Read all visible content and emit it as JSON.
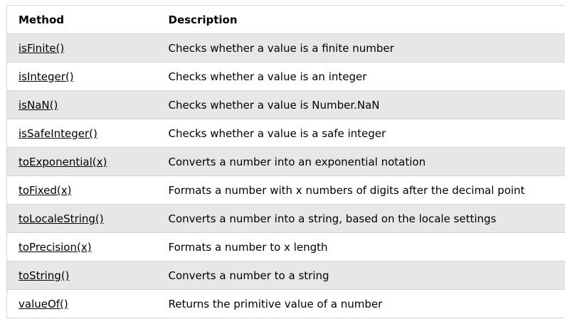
{
  "table": {
    "headers": {
      "method": "Method",
      "description": "Description"
    },
    "rows": [
      {
        "method": "isFinite()",
        "description": "Checks whether a value is a finite number"
      },
      {
        "method": "isInteger()",
        "description": "Checks whether a value is an integer"
      },
      {
        "method": "isNaN()",
        "description": "Checks whether a value is Number.NaN"
      },
      {
        "method": "isSafeInteger()",
        "description": "Checks whether a value is a safe integer"
      },
      {
        "method": "toExponential(x)",
        "description": "Converts a number into an exponential notation"
      },
      {
        "method": "toFixed(x)",
        "description": "Formats a number with x numbers of digits after the decimal point"
      },
      {
        "method": "toLocaleString()",
        "description": "Converts a number into a string, based on the locale settings"
      },
      {
        "method": "toPrecision(x)",
        "description": "Formats a number to x length"
      },
      {
        "method": "toString()",
        "description": "Converts a number to a string"
      },
      {
        "method": "valueOf()",
        "description": "Returns the primitive value of a number"
      }
    ]
  },
  "colors": {
    "stripe": "#e7e7e7",
    "border": "#d4d4d4",
    "text": "#000000"
  }
}
